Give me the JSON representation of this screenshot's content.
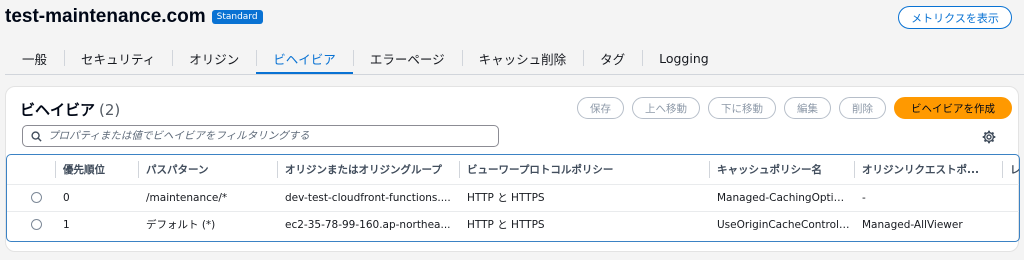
{
  "header": {
    "title": "test-maintenance.com",
    "badge": "Standard",
    "metrics_button": "メトリクスを表示"
  },
  "tabs": [
    {
      "label": "一般",
      "active": false
    },
    {
      "label": "セキュリティ",
      "active": false
    },
    {
      "label": "オリジン",
      "active": false
    },
    {
      "label": "ビヘイビア",
      "active": true
    },
    {
      "label": "エラーページ",
      "active": false
    },
    {
      "label": "キャッシュ削除",
      "active": false
    },
    {
      "label": "タグ",
      "active": false
    },
    {
      "label": "Logging",
      "active": false
    }
  ],
  "panel": {
    "title": "ビヘイビア",
    "count": "(2)",
    "buttons": {
      "save": "保存",
      "move_up": "上へ移動",
      "move_down": "下に移動",
      "edit": "編集",
      "delete": "削除",
      "create": "ビヘイビアを作成"
    },
    "search_placeholder": "プロパティまたは値でビヘイビアをフィルタリングする"
  },
  "table": {
    "columns": {
      "priority": "優先順位",
      "path": "パスパターン",
      "origin": "オリジンまたはオリジングループ",
      "viewer": "ビューワープロトコルポリシー",
      "cache": "キャッシュポリシー名",
      "origin_request": "オリジンリクエストポ...",
      "extra": "レ"
    },
    "rows": [
      {
        "priority": "0",
        "path": "/maintenance/*",
        "origin": "dev-test-cloudfront-functions....",
        "viewer": "HTTP と HTTPS",
        "cache": "Managed-CachingOptimized",
        "origin_request": "-"
      },
      {
        "priority": "1",
        "path": "デフォルト (*)",
        "origin": "ec2-35-78-99-160.ap-northea...",
        "viewer": "HTTP と HTTPS",
        "cache": "UseOriginCacheControlHeaders",
        "origin_request": "Managed-AllViewer"
      }
    ]
  },
  "colors": {
    "accent": "#0972d3",
    "primary_button": "#ff9900"
  }
}
